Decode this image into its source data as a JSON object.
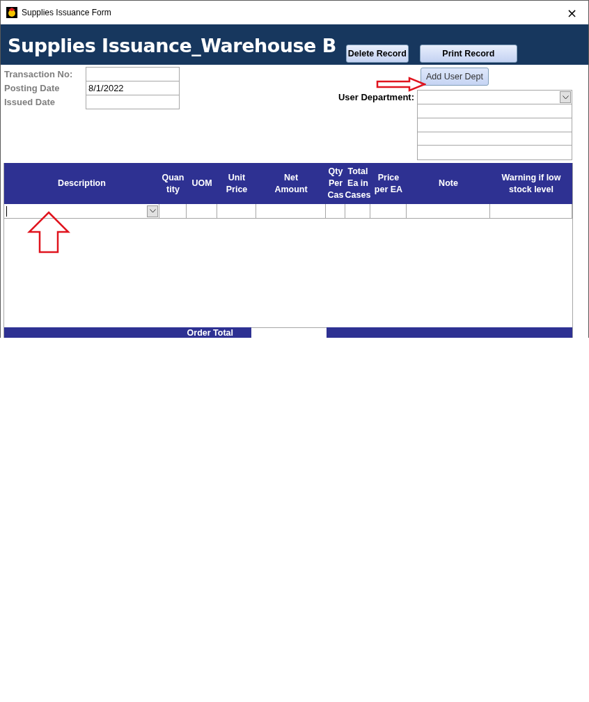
{
  "window": {
    "title": "Supplies Issuance Form",
    "close": "×"
  },
  "header": {
    "title": "Supplies Issuance_Warehouse B",
    "buttons": [
      "Delete Record",
      "Print Record"
    ]
  },
  "fields": [
    {
      "label": "Transaction No:"
    },
    {
      "label": "Posting Date",
      "value": "8/1/2022"
    },
    {
      "label": "Issued Date"
    }
  ],
  "add_button": "Add User Dept",
  "user_department": {
    "label": "User Department:"
  },
  "table": {
    "columns": [
      "Description",
      "Quan\ntity",
      "UOM",
      "Unit\nPrice",
      "Net\nAmount",
      "Qty\nPer\nCas",
      "Total\nEa in\nCases",
      "Price\nper EA",
      "Note",
      "Warning if low\nstock level"
    ]
  },
  "footer": {
    "label": "Order Total"
  }
}
